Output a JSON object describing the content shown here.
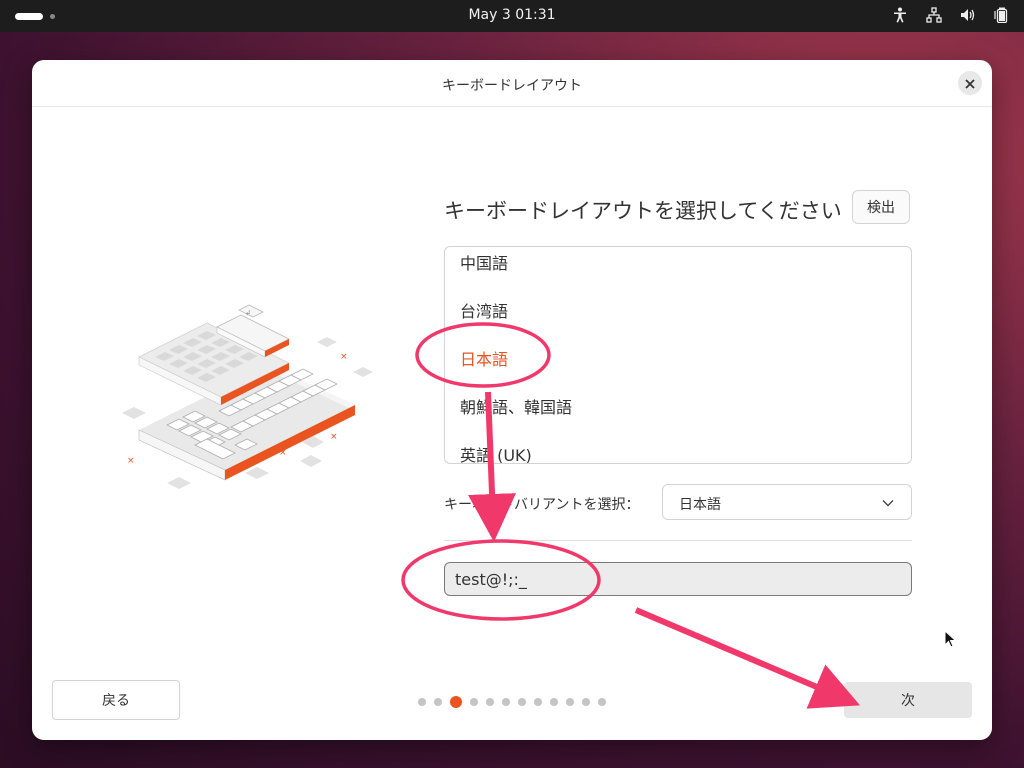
{
  "topbar": {
    "clock": "May 3  01:31"
  },
  "icons": {
    "accessibility": "accessibility-icon",
    "network": "network-icon",
    "volume": "volume-icon",
    "battery": "battery-icon",
    "close": "close-icon",
    "chevron": "chevron-down-icon"
  },
  "dialog": {
    "title": "キーボードレイアウト",
    "heading": "キーボードレイアウトを選択してください",
    "detect_label": "検出",
    "layouts": [
      {
        "label": "中国語",
        "selected": false
      },
      {
        "label": "台湾語",
        "selected": false
      },
      {
        "label": "日本語",
        "selected": true
      },
      {
        "label": "朝鮮語、韓国語",
        "selected": false
      },
      {
        "label": "英語 (UK)",
        "selected": false
      }
    ],
    "variant_label": "キーボードバリアントを選択：",
    "variant_value": "日本語",
    "test_input_value": "test@!;:_",
    "back_label": "戻る",
    "next_label": "次",
    "progress": {
      "total": 12,
      "current": 3
    }
  },
  "colors": {
    "accent": "#e95420",
    "annotation": "#f0386b"
  }
}
